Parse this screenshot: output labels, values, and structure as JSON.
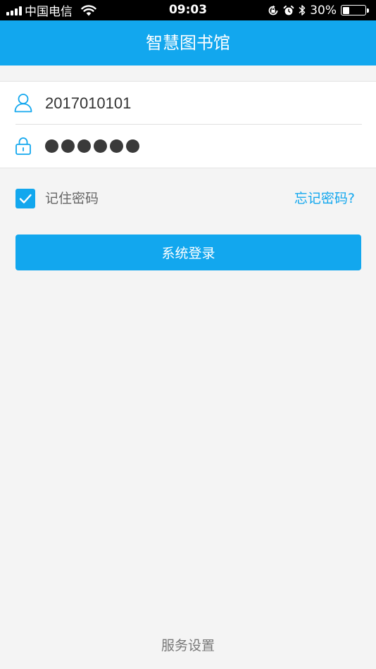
{
  "status_bar": {
    "carrier": "中国电信",
    "time": "09:03",
    "battery_percent": "30%",
    "battery_level": 0.3,
    "icons": [
      "signal-icon",
      "wifi-icon",
      "orientation-lock-icon",
      "alarm-icon",
      "bluetooth-icon",
      "battery-icon"
    ]
  },
  "header": {
    "title": "智慧图书馆"
  },
  "login_form": {
    "username": {
      "value": "2017010101",
      "icon": "user-icon"
    },
    "password": {
      "masked_length": 6,
      "icon": "lock-icon"
    }
  },
  "remember": {
    "label": "记住密码",
    "checked": true
  },
  "forgot_password_label": "忘记密码?",
  "login_button_label": "系统登录",
  "footer": {
    "service_settings_label": "服务设置"
  },
  "colors": {
    "accent": "#12a7ee",
    "background": "#f4f4f4",
    "status_bar": "#000000"
  }
}
